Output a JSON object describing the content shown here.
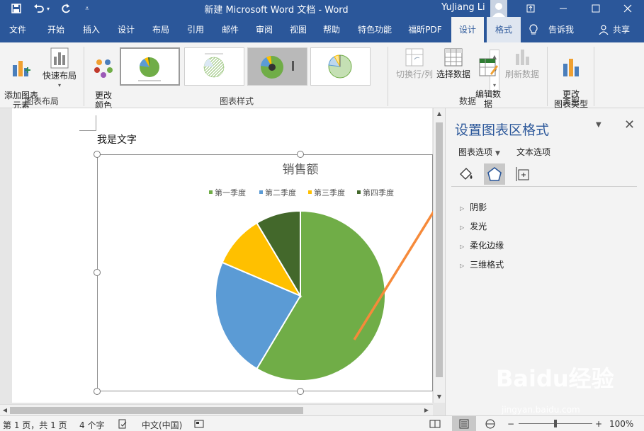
{
  "titlebar": {
    "title": "新建 Microsoft Word 文档  -  Word",
    "user": "YuJiang Li",
    "qa_icons": [
      "save-icon",
      "undo-icon",
      "redo-icon",
      "customize-icon"
    ],
    "window_controls": [
      "ribbon-display-icon",
      "minimize-icon",
      "maximize-icon",
      "close-icon"
    ]
  },
  "tabs": [
    {
      "label": "文件"
    },
    {
      "label": "开始"
    },
    {
      "label": "插入"
    },
    {
      "label": "设计"
    },
    {
      "label": "布局"
    },
    {
      "label": "引用"
    },
    {
      "label": "邮件"
    },
    {
      "label": "审阅"
    },
    {
      "label": "视图"
    },
    {
      "label": "帮助"
    },
    {
      "label": "特色功能"
    },
    {
      "label": "福昕PDF"
    },
    {
      "label": "设计"
    },
    {
      "label": "格式"
    }
  ],
  "tell_me": "告诉我",
  "share": "共享",
  "ribbon": {
    "add_element": "添加图表\n元素",
    "quick_layout": "快速布局",
    "layout_group": "图表布局",
    "change_colors": "更改\n颜色",
    "styles_group": "图表样式",
    "switch_rowcol": "切换行/列",
    "select_data": "选择数据",
    "edit_data": "编辑数\n据",
    "refresh_data": "刷新数据",
    "data_group": "数据",
    "change_type": "更改\n图表类型",
    "type_group": "类型"
  },
  "document": {
    "text": "我是文字"
  },
  "chart_data": {
    "type": "pie",
    "title": "销售额",
    "categories": [
      "第一季度",
      "第二季度",
      "第三季度",
      "第四季度"
    ],
    "values": [
      8.2,
      3.2,
      1.4,
      1.2
    ],
    "colors": [
      "#70ad47",
      "#5b9bd5",
      "#ffc000",
      "#43682b"
    ],
    "legend": "top"
  },
  "pane": {
    "title": "设置图表区格式",
    "tab_chart_options": "图表选项",
    "tab_text_options": "文本选项",
    "sections": [
      {
        "label": "阴影"
      },
      {
        "label": "发光"
      },
      {
        "label": "柔化边缘"
      },
      {
        "label": "三维格式"
      }
    ]
  },
  "status": {
    "page": "第 1 页，共 1 页",
    "words": "4 个字",
    "language": "中文(中国)",
    "zoom": "100%"
  },
  "accent_color": "#2b579a",
  "arrow_color": "#f68a3a",
  "watermark": {
    "brand": "Baidu经验",
    "url": "jingyan.baidu.com"
  }
}
